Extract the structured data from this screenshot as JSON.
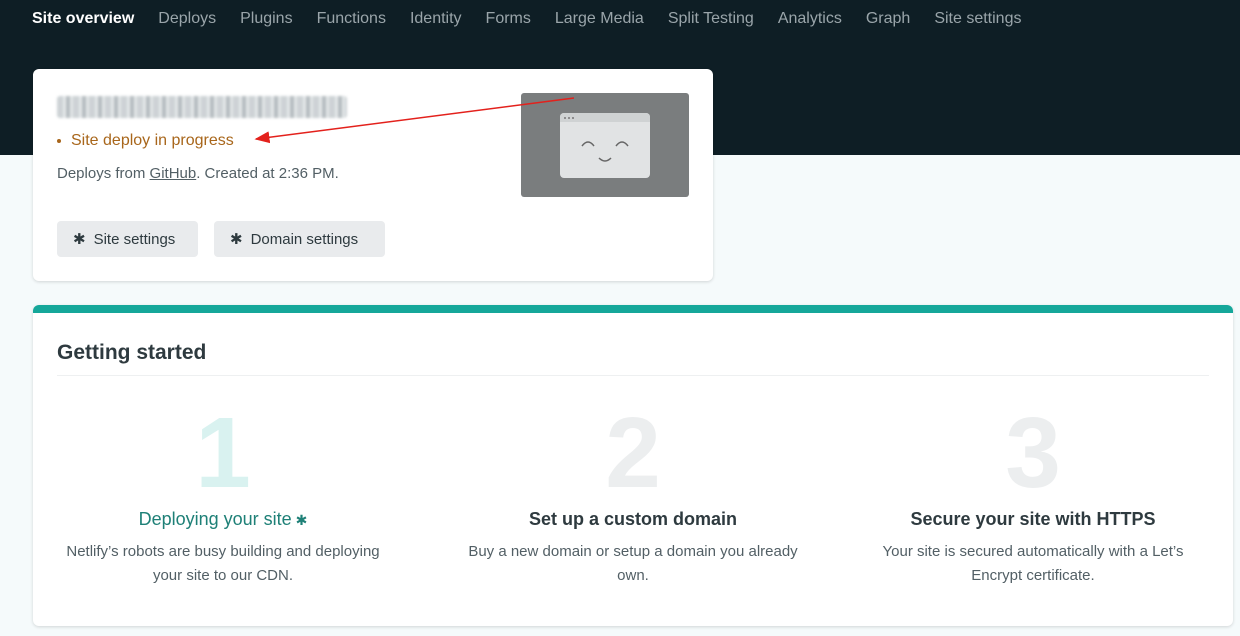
{
  "nav": {
    "items": [
      {
        "label": "Site overview",
        "active": true
      },
      {
        "label": "Deploys"
      },
      {
        "label": "Plugins"
      },
      {
        "label": "Functions"
      },
      {
        "label": "Identity"
      },
      {
        "label": "Forms"
      },
      {
        "label": "Large Media"
      },
      {
        "label": "Split Testing"
      },
      {
        "label": "Analytics"
      },
      {
        "label": "Graph"
      },
      {
        "label": "Site settings"
      }
    ]
  },
  "site": {
    "status": "Site deploy in progress",
    "deploys_from_prefix": "Deploys from ",
    "deploys_from_link": "GitHub",
    "created_text": ". Created at 2:36 PM.",
    "site_settings_label": "Site settings",
    "domain_settings_label": "Domain settings"
  },
  "getting_started": {
    "title": "Getting started",
    "steps": [
      {
        "number": "1",
        "title": "Deploying your site",
        "desc": "Netlify’s robots are busy building and deploying your site to our CDN."
      },
      {
        "number": "2",
        "title": "Set up a custom domain",
        "desc": "Buy a new domain or setup a domain you already own."
      },
      {
        "number": "3",
        "title": "Secure your site with HTTPS",
        "desc": "Your site is secured automatically with a Let’s Encrypt certificate."
      }
    ]
  },
  "colors": {
    "header_bg": "#0e1e25",
    "accent_teal": "#15a79a",
    "deploy_status": "#a8661b",
    "annotation_arrow": "#e3211c"
  },
  "icons": {
    "gear": "gear-icon",
    "preview": "browser-smiley-icon"
  }
}
